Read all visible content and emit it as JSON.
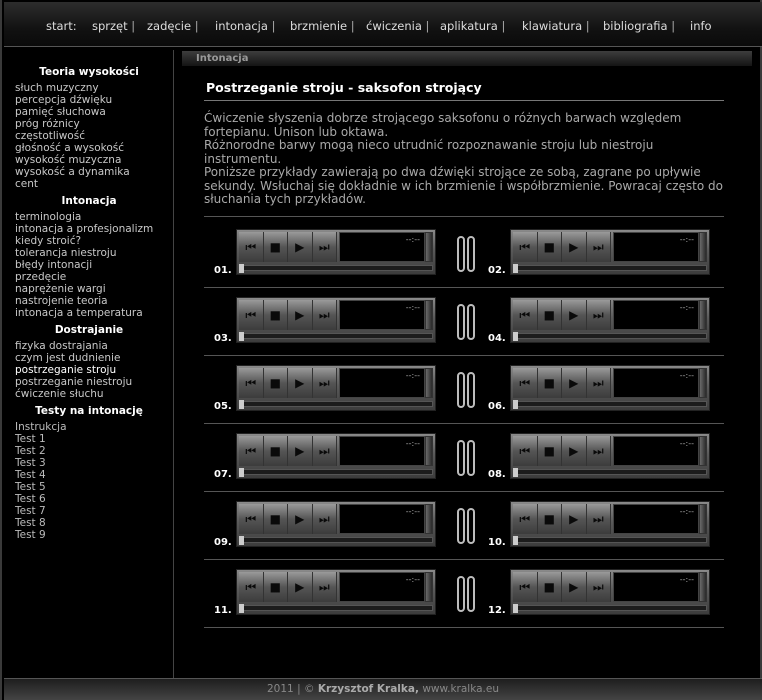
{
  "nav": {
    "items": [
      {
        "label": "start:",
        "sep": ""
      },
      {
        "label": "sprzęt",
        "sep": "|"
      },
      {
        "label": "zadęcie",
        "sep": "|"
      },
      {
        "label": "intonacja",
        "sep": "|"
      },
      {
        "label": "brzmienie",
        "sep": "|"
      },
      {
        "label": "ćwiczenia",
        "sep": "|"
      },
      {
        "label": "aplikatura",
        "sep": "|"
      },
      {
        "label": "klawiatura",
        "sep": "|"
      },
      {
        "label": "bibliografia",
        "sep": "|"
      },
      {
        "label": "info",
        "sep": ""
      }
    ]
  },
  "sidebar": {
    "sections": [
      {
        "title": "Teoria wysokości",
        "links": [
          "słuch muzyczny",
          "percepcja dźwięku",
          "pamięć słuchowa",
          "próg różnicy",
          "częstotliwość",
          "głośność a wysokość",
          "wysokość muzyczna",
          "wysokość a dynamika",
          "cent"
        ]
      },
      {
        "title": "Intonacja",
        "links": [
          "terminologia",
          "intonacja a profesjonalizm",
          "kiedy stroić?",
          "tolerancja niestroju",
          "błędy intonacji",
          "przedęcie",
          "naprężenie wargi",
          "nastrojenie teoria",
          "intonacja a temperatura"
        ]
      },
      {
        "title": "Dostrajanie",
        "links": [
          "fizyka dostrajania",
          "czym jest dudnienie",
          "postrzeganie stroju",
          "postrzeganie niestroju",
          "ćwiczenie słuchu"
        ],
        "active": "postrzeganie stroju"
      },
      {
        "title": "Testy na intonację",
        "links": [
          "Instrukcja",
          "Test 1",
          "Test 2",
          "Test 3",
          "Test 4",
          "Test 5",
          "Test 6",
          "Test 7",
          "Test 8",
          "Test 9"
        ]
      }
    ]
  },
  "breadcrumb": "Intonacja",
  "main": {
    "title": "Postrzeganie stroju - saksofon strojący",
    "intro": [
      "Ćwiczenie słyszenia dobrze strojącego saksofonu o różnych barwach względem fortepianu. Unison lub oktawa.",
      "Różnorodne barwy mogą nieco utrudnić rozpoznawanie stroju lub niestroju instrumentu.",
      "Poniższe przykłady zawierają po dwa dźwięki strojące ze sobą, zagrane po upływie sekundy. Wsłuchaj się dokładnie w ich brzmienie i współbrzmienie. Powracaj często do słuchania tych przykładów."
    ]
  },
  "players": [
    {
      "num": "01.",
      "time": "--:--"
    },
    {
      "num": "02.",
      "time": "--:--"
    },
    {
      "num": "03.",
      "time": "--:--"
    },
    {
      "num": "04.",
      "time": "--:--"
    },
    {
      "num": "05.",
      "time": "--:--"
    },
    {
      "num": "06.",
      "time": "--:--"
    },
    {
      "num": "07.",
      "time": "--:--"
    },
    {
      "num": "08.",
      "time": "--:--"
    },
    {
      "num": "09.",
      "time": "--:--"
    },
    {
      "num": "10.",
      "time": "--:--"
    },
    {
      "num": "11.",
      "time": "--:--"
    },
    {
      "num": "12.",
      "time": "--:--"
    }
  ],
  "player_controls": {
    "prev": "⏮",
    "stop": "■",
    "play": "▶",
    "next": "⏭"
  },
  "footer": {
    "year": "2011",
    "sep": "|",
    "copyright": "©",
    "author": "Krzysztof Kralka,",
    "site": "www.kralka.eu"
  }
}
